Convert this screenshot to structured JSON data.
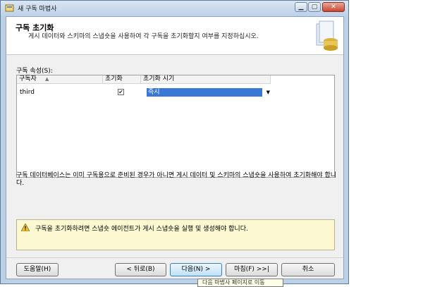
{
  "window": {
    "title": "새 구독 마법사",
    "icons": {
      "app": "wizard-app-icon",
      "minimize": "minimize-icon",
      "maximize": "maximize-icon",
      "close": "close-icon"
    }
  },
  "header": {
    "title": "구독 초기화",
    "subtitle": "게시 데이터와 스키마의 스냅숏을 사용하여 각 구독을 초기화할지 여부를 지정하십시오."
  },
  "grid": {
    "section_label": "구독 속성(S):",
    "columns": [
      "구독자",
      "초기화",
      "초기화 시기"
    ],
    "rows": [
      {
        "subscriber": "third",
        "initialize": true,
        "when": "즉시"
      }
    ]
  },
  "note": "구독 데이터베이스는 이미 구독용으로 준비된 경우가 아니면 게시 데이터 및 스키마의 스냅숏을 사용하여 초기화해야 합니다.",
  "warning": {
    "icon": "warning-icon",
    "text": "구독을 초기화하려면 스냅숏 에이전트가 게시 스냅숏을 실행 및 생성해야 합니다."
  },
  "buttons": {
    "help": "도움말(H)",
    "back": "< 뒤로(B)",
    "next": "다음(N) >",
    "finish": "마침(F) >>|",
    "cancel": "취소"
  },
  "tooltip": "다음 마법사 페이지로 이동",
  "colors": {
    "accent": "#3a78d6",
    "warning_bg": "#fbf8d2",
    "frame": "#bcd0e6"
  }
}
